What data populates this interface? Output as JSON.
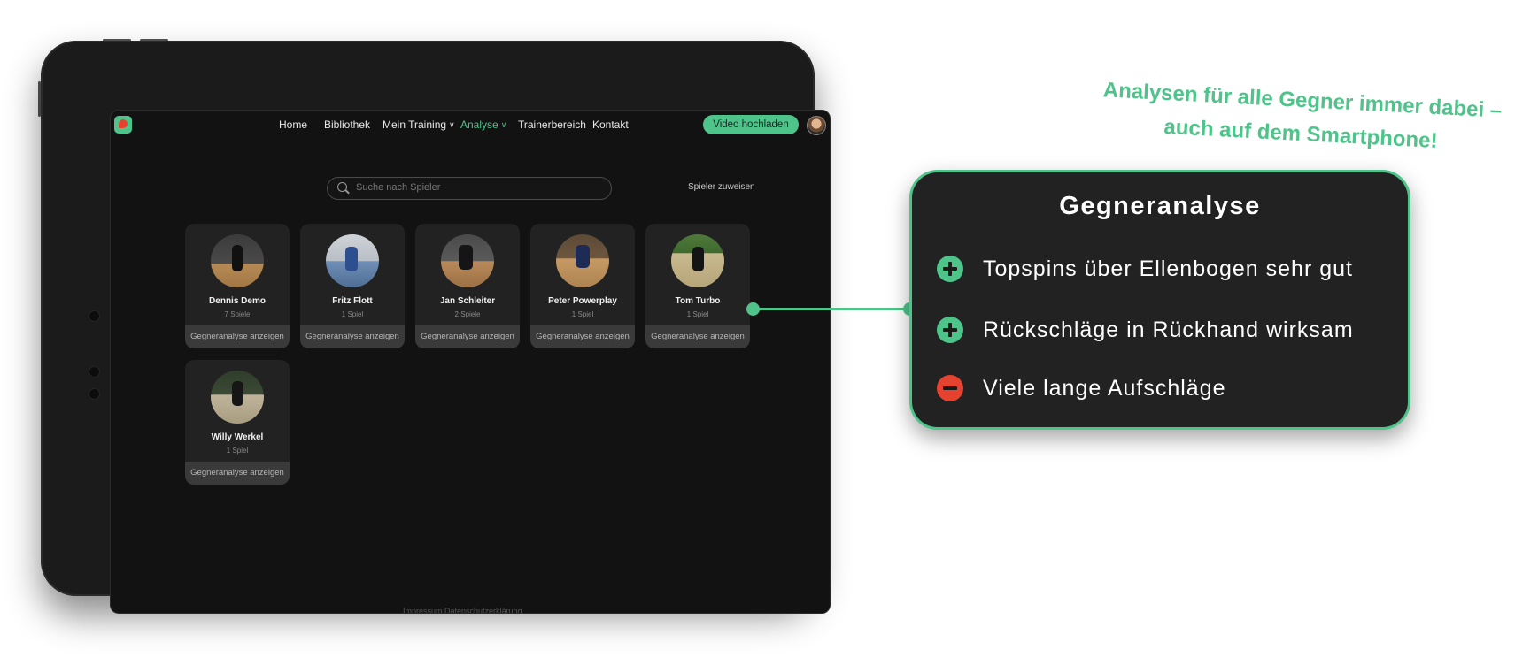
{
  "nav": {
    "home": "Home",
    "library": "Bibliothek",
    "training": "Mein Training",
    "analysis": "Analyse",
    "coach": "Trainerbereich",
    "contact": "Kontakt",
    "upload": "Video hochladen"
  },
  "search": {
    "placeholder": "Suche nach Spieler"
  },
  "assign_label": "Spieler zuweisen",
  "players": [
    {
      "name": "Dennis Demo",
      "games": "7 Spiele",
      "action": "Gegneranalyse anzeigen"
    },
    {
      "name": "Fritz Flott",
      "games": "1 Spiel",
      "action": "Gegneranalyse anzeigen"
    },
    {
      "name": "Jan Schleiter",
      "games": "2 Spiele",
      "action": "Gegneranalyse anzeigen"
    },
    {
      "name": "Peter Powerplay",
      "games": "1 Spiel",
      "action": "Gegneranalyse anzeigen"
    },
    {
      "name": "Tom Turbo",
      "games": "1 Spiel",
      "action": "Gegneranalyse anzeigen"
    },
    {
      "name": "Willy Werkel",
      "games": "1 Spiel",
      "action": "Gegneranalyse anzeigen"
    }
  ],
  "footer": "Impressum Datenschutzerklärung",
  "callout": {
    "title": "Gegneranalyse",
    "items": [
      {
        "type": "plus",
        "text": "Topspins über Ellenbogen sehr gut"
      },
      {
        "type": "plus",
        "text": "Rückschläge in Rückhand wirksam"
      },
      {
        "type": "minus",
        "text": "Viele lange Aufschläge"
      }
    ]
  },
  "tagline": {
    "line1": "Analysen für alle Gegner immer dabei –",
    "line2": "auch auf dem Smartphone!"
  },
  "colors": {
    "accent": "#4ec48a",
    "negative": "#e5432f",
    "screen_bg": "#121212",
    "card_bg": "#222222"
  }
}
